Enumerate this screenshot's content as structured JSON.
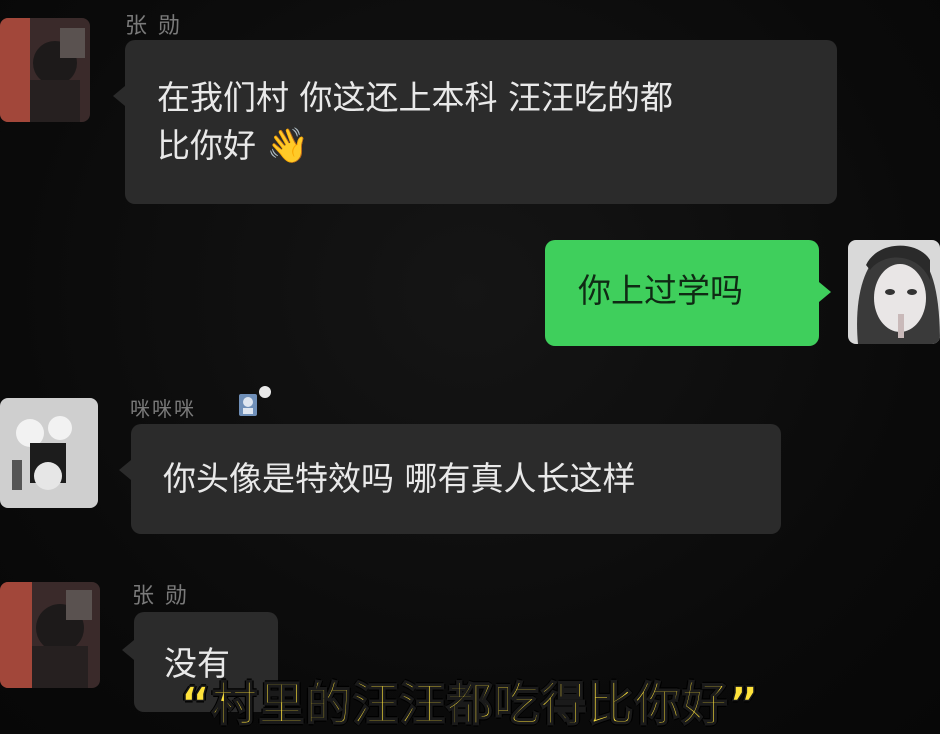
{
  "messages": [
    {
      "sender": "张 勋",
      "text_line1": "在我们村 你这还上本科 汪汪吃的都",
      "text_line2": "比你好",
      "emoji": "👋"
    },
    {
      "text": "你上过学吗"
    },
    {
      "sender": "咪咪咪",
      "text": "你头像是特效吗 哪有真人长这样"
    },
    {
      "sender": "张 勋",
      "text": "没有"
    }
  ],
  "caption": "“村里的汪汪都吃得比你好”",
  "colors": {
    "background": "#0b0b0b",
    "incoming_bubble": "#2b2b2b",
    "outgoing_bubble": "#3fcf5c",
    "caption": "#ffe33b"
  }
}
